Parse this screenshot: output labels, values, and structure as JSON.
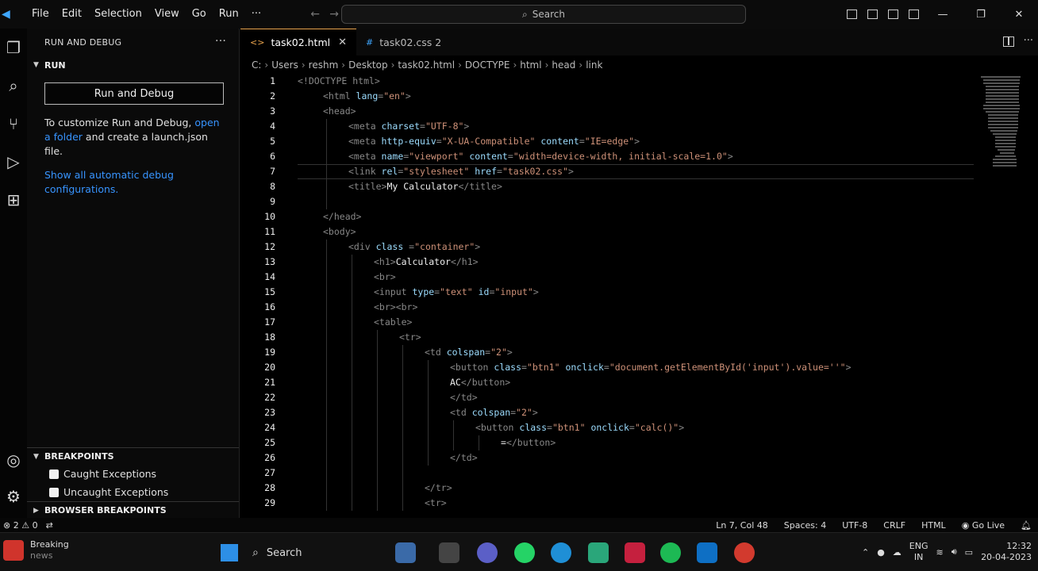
{
  "menu": {
    "items": [
      "File",
      "Edit",
      "Selection",
      "View",
      "Go",
      "Run",
      "···"
    ],
    "search_label": "Search"
  },
  "sidebar": {
    "header": "RUN AND DEBUG",
    "run_section": "RUN",
    "run_button": "Run and Debug",
    "customize_text_before": "To customize Run and Debug,",
    "open_folder_link": "open a folder",
    "customize_text_after": "and create a launch.json file.",
    "show_configs_link": "Show all automatic debug configurations.",
    "breakpoints_title": "BREAKPOINTS",
    "breakpoints": [
      "Caught Exceptions",
      "Uncaught Exceptions"
    ],
    "browser_breakpoints_title": "BROWSER BREAKPOINTS"
  },
  "tabs": [
    {
      "label": "task02.html",
      "active": true,
      "icon": "html-file-icon"
    },
    {
      "label": "task02.css 2",
      "active": false,
      "icon": "css-file-icon"
    }
  ],
  "breadcrumb": [
    "C:",
    "Users",
    "reshm",
    "Desktop",
    "task02.html",
    "DOCTYPE",
    "html",
    "head",
    "link"
  ],
  "code": {
    "lines": [
      {
        "n": "1",
        "indent": 0,
        "parts": [
          [
            "tag",
            "<!DOCTYPE html>"
          ]
        ]
      },
      {
        "n": "2",
        "indent": 1,
        "parts": [
          [
            "tag",
            "<html "
          ],
          [
            "attr",
            "lang"
          ],
          [
            "tag",
            "="
          ],
          [
            "str",
            "\"en\""
          ],
          [
            "tag",
            ">"
          ]
        ]
      },
      {
        "n": "3",
        "indent": 1,
        "parts": [
          [
            "tag",
            "<head>"
          ]
        ]
      },
      {
        "n": "4",
        "indent": 2,
        "parts": [
          [
            "tag",
            "<meta "
          ],
          [
            "attr",
            "charset"
          ],
          [
            "tag",
            "="
          ],
          [
            "str",
            "\"UTF-8\""
          ],
          [
            "tag",
            ">"
          ]
        ]
      },
      {
        "n": "5",
        "indent": 2,
        "parts": [
          [
            "tag",
            "<meta "
          ],
          [
            "attr",
            "http-equiv"
          ],
          [
            "tag",
            "="
          ],
          [
            "str",
            "\"X-UA-Compatible\""
          ],
          [
            "tag",
            " "
          ],
          [
            "attr",
            "content"
          ],
          [
            "tag",
            "="
          ],
          [
            "str",
            "\"IE=edge\""
          ],
          [
            "tag",
            ">"
          ]
        ]
      },
      {
        "n": "6",
        "indent": 2,
        "parts": [
          [
            "tag",
            "<meta "
          ],
          [
            "attr",
            "name"
          ],
          [
            "tag",
            "="
          ],
          [
            "str",
            "\"viewport\""
          ],
          [
            "tag",
            " "
          ],
          [
            "attr",
            "content"
          ],
          [
            "tag",
            "="
          ],
          [
            "str",
            "\"width=device-width, initial-scale=1.0\""
          ],
          [
            "tag",
            ">"
          ]
        ]
      },
      {
        "n": "7",
        "indent": 2,
        "parts": [
          [
            "tag",
            "<link "
          ],
          [
            "attr",
            "rel"
          ],
          [
            "tag",
            "="
          ],
          [
            "str",
            "\"stylesheet\""
          ],
          [
            "tag",
            " "
          ],
          [
            "attr",
            "href"
          ],
          [
            "tag",
            "="
          ],
          [
            "str",
            "\"task02.css\""
          ],
          [
            "tag",
            ">"
          ]
        ]
      },
      {
        "n": "8",
        "indent": 2,
        "parts": [
          [
            "tag",
            "<title>"
          ],
          [
            "txt",
            "My Calculator"
          ],
          [
            "tag",
            "</title>"
          ]
        ]
      },
      {
        "n": "9",
        "indent": 2,
        "parts": []
      },
      {
        "n": "10",
        "indent": 1,
        "parts": [
          [
            "tag",
            "</head>"
          ]
        ]
      },
      {
        "n": "11",
        "indent": 1,
        "parts": [
          [
            "tag",
            "<body>"
          ]
        ]
      },
      {
        "n": "12",
        "indent": 2,
        "parts": [
          [
            "tag",
            "<div "
          ],
          [
            "attr",
            "class"
          ],
          [
            "tag",
            " ="
          ],
          [
            "str",
            "\"container\""
          ],
          [
            "tag",
            ">"
          ]
        ]
      },
      {
        "n": "13",
        "indent": 3,
        "parts": [
          [
            "tag",
            "<h1>"
          ],
          [
            "txt",
            "Calculator"
          ],
          [
            "tag",
            "</h1>"
          ]
        ]
      },
      {
        "n": "14",
        "indent": 3,
        "parts": [
          [
            "tag",
            "<br>"
          ]
        ]
      },
      {
        "n": "15",
        "indent": 3,
        "parts": [
          [
            "tag",
            "<input "
          ],
          [
            "attr",
            "type"
          ],
          [
            "tag",
            "="
          ],
          [
            "str",
            "\"text\""
          ],
          [
            "tag",
            " "
          ],
          [
            "attr",
            "id"
          ],
          [
            "tag",
            "="
          ],
          [
            "str",
            "\"input\""
          ],
          [
            "tag",
            ">"
          ]
        ]
      },
      {
        "n": "16",
        "indent": 3,
        "parts": [
          [
            "tag",
            "<br><br>"
          ]
        ]
      },
      {
        "n": "17",
        "indent": 3,
        "parts": [
          [
            "tag",
            "<table>"
          ]
        ]
      },
      {
        "n": "18",
        "indent": 4,
        "parts": [
          [
            "tag",
            "<tr>"
          ]
        ]
      },
      {
        "n": "19",
        "indent": 5,
        "parts": [
          [
            "tag",
            "<td "
          ],
          [
            "attr",
            "colspan"
          ],
          [
            "tag",
            "="
          ],
          [
            "str",
            "\"2\""
          ],
          [
            "tag",
            ">"
          ]
        ]
      },
      {
        "n": "20",
        "indent": 6,
        "parts": [
          [
            "tag",
            "<button "
          ],
          [
            "attr",
            "class"
          ],
          [
            "tag",
            "="
          ],
          [
            "str",
            "\"btn1\""
          ],
          [
            "tag",
            " "
          ],
          [
            "attr",
            "onclick"
          ],
          [
            "tag",
            "="
          ],
          [
            "str",
            "\"document.getElementById('input').value=''\""
          ],
          [
            "tag",
            ">"
          ]
        ]
      },
      {
        "n": "21",
        "indent": 6,
        "parts": [
          [
            "txt",
            "AC"
          ],
          [
            "tag",
            "</button>"
          ]
        ]
      },
      {
        "n": "22",
        "indent": 6,
        "parts": [
          [
            "tag",
            "</td>"
          ]
        ]
      },
      {
        "n": "23",
        "indent": 6,
        "parts": [
          [
            "tag",
            "<td "
          ],
          [
            "attr",
            "colspan"
          ],
          [
            "tag",
            "="
          ],
          [
            "str",
            "\"2\""
          ],
          [
            "tag",
            ">"
          ]
        ]
      },
      {
        "n": "24",
        "indent": 7,
        "parts": [
          [
            "tag",
            "<button "
          ],
          [
            "attr",
            "class"
          ],
          [
            "tag",
            "="
          ],
          [
            "str",
            "\"btn1\""
          ],
          [
            "tag",
            " "
          ],
          [
            "attr",
            "onclick"
          ],
          [
            "tag",
            "="
          ],
          [
            "str",
            "\"calc()\""
          ],
          [
            "tag",
            ">"
          ]
        ]
      },
      {
        "n": "25",
        "indent": 8,
        "parts": [
          [
            "txt",
            "="
          ],
          [
            "tag",
            "</button>"
          ]
        ]
      },
      {
        "n": "26",
        "indent": 6,
        "parts": [
          [
            "tag",
            "</td>"
          ]
        ]
      },
      {
        "n": "27",
        "indent": 5,
        "parts": []
      },
      {
        "n": "28",
        "indent": 5,
        "parts": [
          [
            "tag",
            "</tr>"
          ]
        ]
      },
      {
        "n": "29",
        "indent": 5,
        "parts": [
          [
            "tag",
            "<tr>"
          ]
        ]
      }
    ]
  },
  "status": {
    "errors": "2",
    "warnings": "0",
    "position": "Ln 7, Col 48",
    "spaces": "Spaces: 4",
    "encoding": "UTF-8",
    "eol": "CRLF",
    "language": "HTML",
    "go_live": "Go Live"
  },
  "taskbar": {
    "news_title": "Breaking",
    "news_sub": "news",
    "search_label": "Search",
    "lang_top": "ENG",
    "lang_bottom": "IN",
    "time": "12:32",
    "date": "20-04-2023"
  },
  "colors": {
    "accent_html": "#e8a34c",
    "accent_css": "#3fa7ff",
    "link": "#3794ff"
  }
}
